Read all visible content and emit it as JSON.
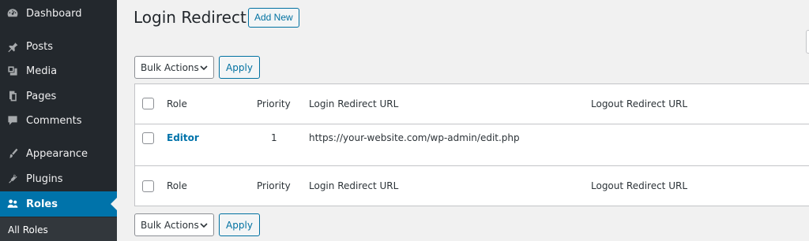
{
  "sidebar": {
    "items": [
      {
        "label": "Dashboard",
        "icon": "dashboard-icon"
      },
      {
        "label": "Posts",
        "icon": "pin-icon"
      },
      {
        "label": "Media",
        "icon": "media-icon"
      },
      {
        "label": "Pages",
        "icon": "pages-icon"
      },
      {
        "label": "Comments",
        "icon": "comment-icon"
      },
      {
        "label": "Appearance",
        "icon": "brush-icon"
      },
      {
        "label": "Plugins",
        "icon": "plugin-icon"
      },
      {
        "label": "Roles",
        "icon": "users-icon",
        "active": true
      }
    ],
    "submenu": {
      "label": "All Roles"
    }
  },
  "header": {
    "title": "Login Redirect",
    "add_new_label": "Add New"
  },
  "bulk_top": {
    "selected": "Bulk Actions",
    "apply_label": "Apply"
  },
  "bulk_bottom": {
    "selected": "Bulk Actions",
    "apply_label": "Apply"
  },
  "table": {
    "columns": [
      "Role",
      "Priority",
      "Login Redirect URL",
      "Logout Redirect URL"
    ],
    "rows": [
      {
        "role": "Editor",
        "priority": "1",
        "login_url": "https://your-website.com/wp-admin/edit.php",
        "logout_url": ""
      }
    ]
  },
  "colors": {
    "sidebar_bg": "#23282d",
    "accent": "#0073aa",
    "page_bg": "#f1f1f1"
  }
}
